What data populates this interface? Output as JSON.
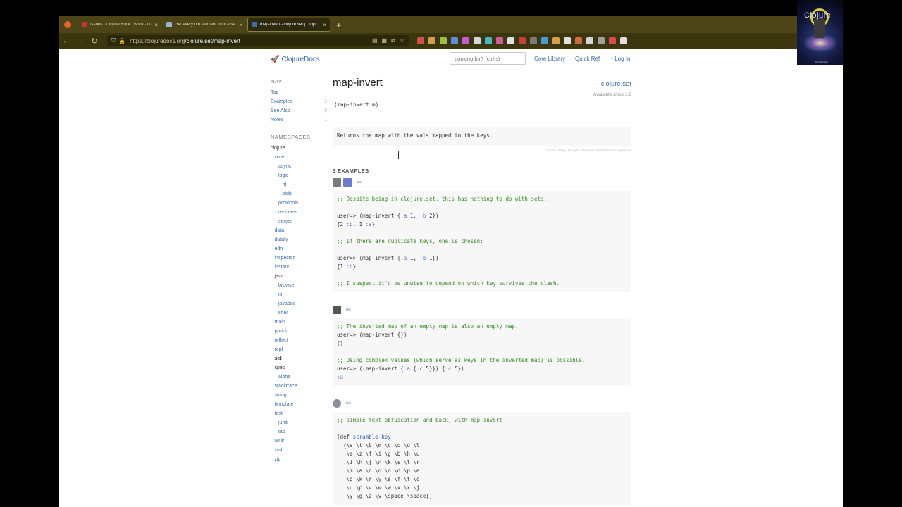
{
  "browser": {
    "tabs": [
      {
        "title": "Issues · Clojure Book / Book · G",
        "color": "#c0392b",
        "active": false
      },
      {
        "title": "Get every nth element from a se",
        "color": "#9bb3d6",
        "active": false
      },
      {
        "title": "map-invert - clojure.set | Cloju",
        "color": "#3b6ea8",
        "active": true
      }
    ],
    "url_host": "https://clojuredocs.org",
    "url_path": "/clojure.set/map-invert",
    "extensions": [
      "#d64b4b",
      "#cfa04a",
      "#9dbf4a",
      "#5a8fd6",
      "#c45bd6",
      "#d6d6d6",
      "#4ab8c4",
      "#d65b9a",
      "#e0e0e0",
      "#c24040",
      "#7a7a7a",
      "#4a9ad6",
      "#d6a04a",
      "#e0e0e0",
      "#cf6b3c",
      "#d6d6d6",
      "#9f9f9f",
      "#d64b4b",
      "#e0e0e0"
    ]
  },
  "site": {
    "logo": "ClojureDocs",
    "search_placeholder": "Looking for? (ctrl-s)",
    "nav": [
      "Core Library",
      "Quick Ref",
      "Log In"
    ]
  },
  "sidebar": {
    "nav_heading": "NAV",
    "nav_items": [
      {
        "label": "Top",
        "count": ""
      },
      {
        "label": "Examples",
        "count": "3"
      },
      {
        "label": "See Also",
        "count": "0"
      },
      {
        "label": "Notes",
        "count": "1"
      }
    ],
    "ns_heading": "NAMESPACES",
    "namespaces": [
      {
        "label": "clojure",
        "indent": 0,
        "style": "cur"
      },
      {
        "label": "core",
        "indent": 1,
        "style": ""
      },
      {
        "label": "async",
        "indent": 2,
        "style": ""
      },
      {
        "label": "logic",
        "indent": 2,
        "style": ""
      },
      {
        "label": "fd",
        "indent": 3,
        "style": ""
      },
      {
        "label": "pldb",
        "indent": 3,
        "style": ""
      },
      {
        "label": "protocols",
        "indent": 2,
        "style": ""
      },
      {
        "label": "reducers",
        "indent": 2,
        "style": ""
      },
      {
        "label": "server",
        "indent": 2,
        "style": ""
      },
      {
        "label": "data",
        "indent": 1,
        "style": ""
      },
      {
        "label": "datafy",
        "indent": 1,
        "style": ""
      },
      {
        "label": "edn",
        "indent": 1,
        "style": ""
      },
      {
        "label": "inspector",
        "indent": 1,
        "style": ""
      },
      {
        "label": "instant",
        "indent": 1,
        "style": ""
      },
      {
        "label": "java",
        "indent": 1,
        "style": "cur"
      },
      {
        "label": "browse",
        "indent": 2,
        "style": ""
      },
      {
        "label": "io",
        "indent": 2,
        "style": ""
      },
      {
        "label": "javadoc",
        "indent": 2,
        "style": ""
      },
      {
        "label": "shell",
        "indent": 2,
        "style": ""
      },
      {
        "label": "main",
        "indent": 1,
        "style": ""
      },
      {
        "label": "pprint",
        "indent": 1,
        "style": ""
      },
      {
        "label": "reflect",
        "indent": 1,
        "style": ""
      },
      {
        "label": "repl",
        "indent": 1,
        "style": ""
      },
      {
        "label": "set",
        "indent": 1,
        "style": "bold"
      },
      {
        "label": "spec",
        "indent": 1,
        "style": "cur"
      },
      {
        "label": "alpha",
        "indent": 2,
        "style": ""
      },
      {
        "label": "stacktrace",
        "indent": 1,
        "style": ""
      },
      {
        "label": "string",
        "indent": 1,
        "style": ""
      },
      {
        "label": "template",
        "indent": 1,
        "style": ""
      },
      {
        "label": "test",
        "indent": 1,
        "style": ""
      },
      {
        "label": "junit",
        "indent": 2,
        "style": ""
      },
      {
        "label": "tap",
        "indent": 2,
        "style": ""
      },
      {
        "label": "walk",
        "indent": 1,
        "style": ""
      },
      {
        "label": "xml",
        "indent": 1,
        "style": ""
      },
      {
        "label": "zip",
        "indent": 1,
        "style": ""
      }
    ]
  },
  "doc": {
    "title": "map-invert",
    "namespace": "clojure.set",
    "since": "Available since 1.0",
    "signature": "(map-invert m)",
    "docstring": "Returns the map with the vals mapped to the keys.",
    "license": "© Rich Hickey. All rights reserved. Eclipse Public License 1.0",
    "examples_heading": "3 EXAMPLES"
  },
  "examples": [
    {
      "avatars": [
        "#7a7a7a",
        "#6a7bd0"
      ],
      "link": "link",
      "lines": [
        [
          [
            "c",
            ";; Despite being in clojure.set, this has nothing to do with sets."
          ]
        ],
        [],
        [
          [
            "",
            "user=> (map-invert {"
          ],
          [
            "k",
            ":a"
          ],
          [
            "",
            " 1, "
          ],
          [
            "k",
            ":b"
          ],
          [
            "",
            " 2})"
          ]
        ],
        [
          [
            "",
            "{2 "
          ],
          [
            "k",
            ":b"
          ],
          [
            "",
            ", 1 "
          ],
          [
            "k",
            ":a"
          ],
          [
            "",
            "}"
          ]
        ],
        [],
        [
          [
            "c",
            ";; If there are duplicate keys, one is chosen:"
          ]
        ],
        [],
        [
          [
            "",
            "user=> (map-invert {"
          ],
          [
            "k",
            ":a"
          ],
          [
            "",
            " 1, "
          ],
          [
            "k",
            ":b"
          ],
          [
            "",
            " 1})"
          ]
        ],
        [
          [
            "",
            "{1 "
          ],
          [
            "k",
            ":b"
          ],
          [
            "",
            "}"
          ]
        ],
        [],
        [
          [
            "c",
            ";; I suspect it'd be unwise to depend on which key survives the clash."
          ]
        ]
      ]
    },
    {
      "avatars": [
        "#555555"
      ],
      "link": "link",
      "lines": [
        [
          [
            "c",
            ";; The inverted map of an empty map is also an empty map."
          ]
        ],
        [
          [
            "",
            "user=> (map-invert {})"
          ]
        ],
        [
          [
            "c",
            "{}"
          ]
        ],
        [],
        [
          [
            "c",
            ";; Using complex values (which serve as keys in the inverted map) is possible."
          ]
        ],
        [
          [
            "",
            "user=> ((map-invert {"
          ],
          [
            "k",
            ":a"
          ],
          [
            "",
            " {"
          ],
          [
            "k",
            ":c"
          ],
          [
            "",
            " 5}}) {"
          ],
          [
            "k",
            ":c"
          ],
          [
            "",
            " 5})"
          ]
        ],
        [
          [
            "k",
            ":a"
          ]
        ]
      ]
    },
    {
      "avatars": [
        "#8a8fa0"
      ],
      "link": "link",
      "lines": [
        [
          [
            "c",
            ";; simple text obfuscation and back, with map-invert"
          ]
        ],
        [],
        [
          [
            "",
            "(def "
          ],
          [
            "s",
            "scramble-key"
          ]
        ],
        [
          [
            "",
            "  {\\a \\t \\b \\m \\c \\o \\d \\l"
          ]
        ],
        [
          [
            "",
            "   \\e \\z \\f \\i \\g \\b \\h \\u"
          ]
        ],
        [
          [
            "",
            "   \\i \\h \\j \\n \\k \\s \\l \\r"
          ]
        ],
        [
          [
            "",
            "   \\m \\a \\n \\q \\o \\d \\p \\e"
          ]
        ],
        [
          [
            "",
            "   \\q \\k \\r \\y \\s \\f \\t \\c"
          ]
        ],
        [
          [
            "",
            "   \\u \\p \\v \\w \\w \\x \\x \\j"
          ]
        ],
        [
          [
            "",
            "   \\y \\g \\z \\v \\space \\space})"
          ]
        ]
      ]
    }
  ],
  "webcam": {
    "text": "Clojure",
    "sub": "Orchestration"
  }
}
